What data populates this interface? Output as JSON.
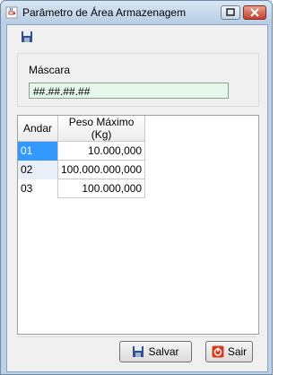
{
  "window": {
    "title": "Parâmetro de Área Armazenagem",
    "icons": {
      "app": "java-cup-icon",
      "restore": "restore-icon",
      "close": "close-icon"
    }
  },
  "toolbar": {
    "icon": "save-icon"
  },
  "mask": {
    "label": "Máscara",
    "value": "##.##.##.##"
  },
  "table": {
    "columns": [
      "Andar",
      "Peso Máximo (Kg)"
    ],
    "rows": [
      {
        "andar": "01",
        "peso": "10.000,000"
      },
      {
        "andar": "02",
        "peso": "100.000.000,000"
      },
      {
        "andar": "03",
        "peso": "100.000,000"
      }
    ]
  },
  "buttons": {
    "salvar": "Salvar",
    "sair": "Sair"
  },
  "colors": {
    "selection": "#3399ff",
    "mask_field_bg": "#e4f7ea",
    "close_button": "#c4402b"
  }
}
